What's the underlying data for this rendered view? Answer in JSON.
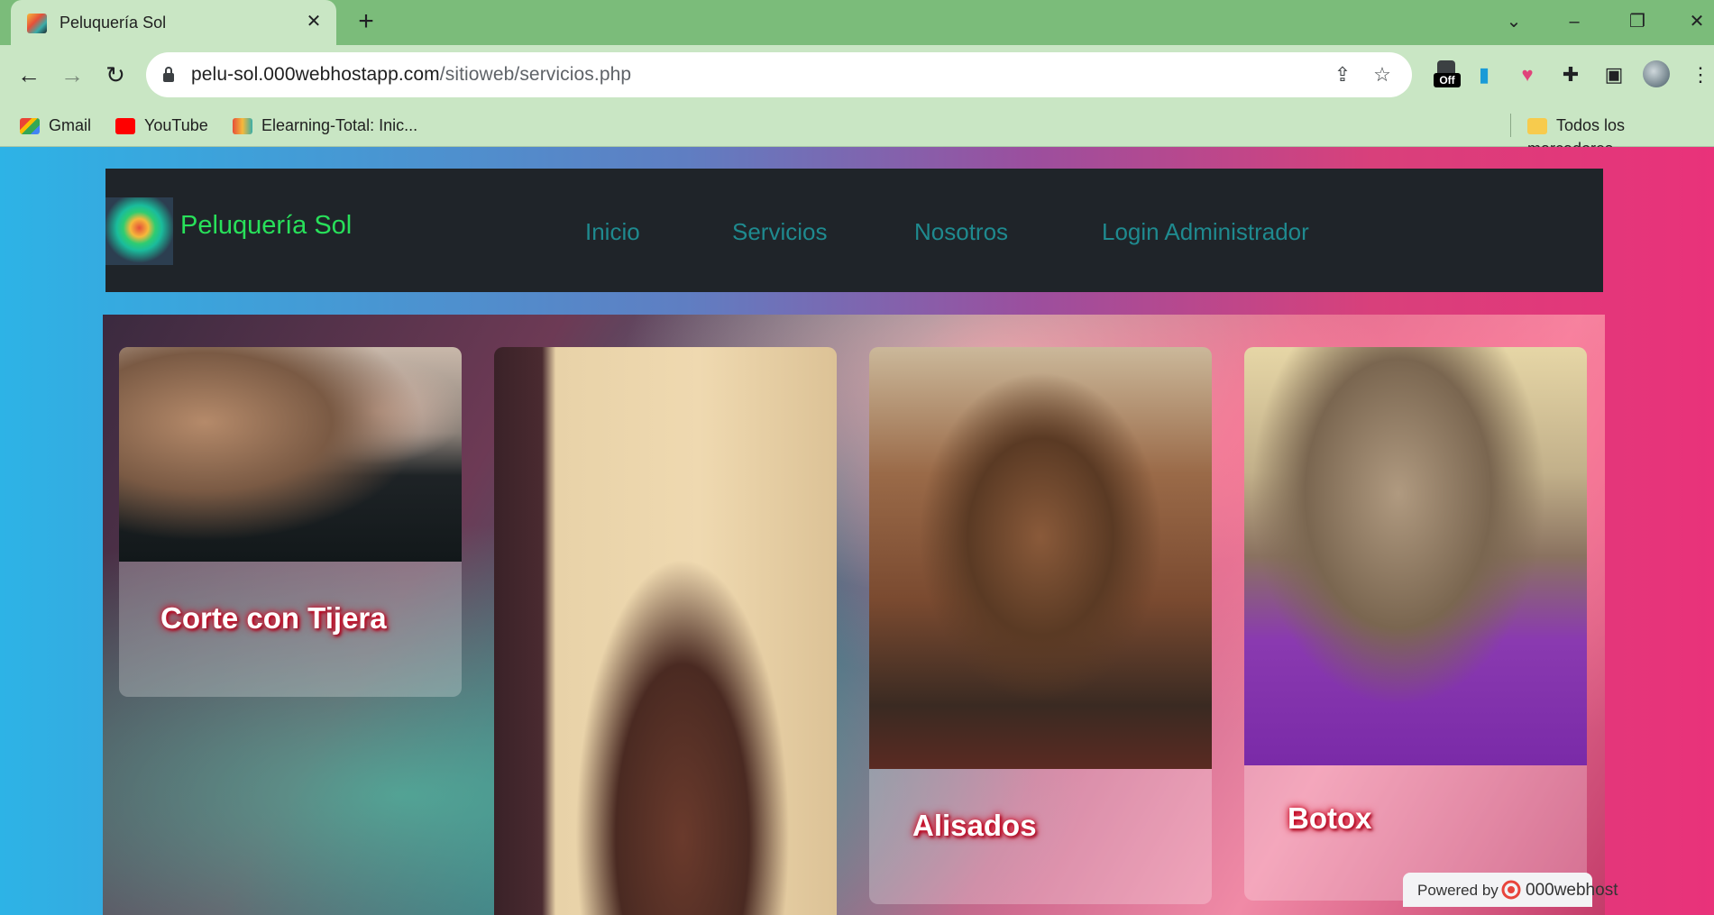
{
  "browser": {
    "tab_title": "Peluquería Sol",
    "url_host": "pelu-sol.000webhostapp.com",
    "url_path": "/sitioweb/servicios.php",
    "bookmarks": [
      {
        "label": "Gmail"
      },
      {
        "label": "YouTube"
      },
      {
        "label": "Elearning-Total: Inic..."
      }
    ],
    "all_bookmarks_label": "Todos los marcadores",
    "extension_badge": "Off"
  },
  "site": {
    "brand": "Peluquería Sol",
    "nav": [
      "Inicio",
      "Servicios",
      "Nosotros",
      "Login Administrador"
    ],
    "services": [
      {
        "title": "Corte con Tijera"
      },
      {
        "title": ""
      },
      {
        "title": "Alisados"
      },
      {
        "title": "Botox"
      }
    ]
  },
  "footer_badge": {
    "prefix": "Powered by",
    "brand": "000webhost"
  },
  "colors": {
    "brand_green": "#28e05a",
    "nav_link": "#1f8a8f",
    "navbar_bg": "#1f2429",
    "tab_strip": "#7bbc7a",
    "chrome_bg": "#c9e6c4"
  }
}
